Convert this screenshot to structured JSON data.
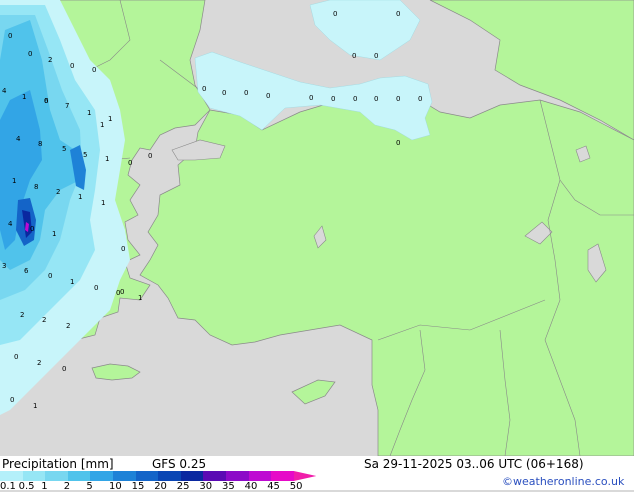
{
  "title": "Precipitation [mm]",
  "model": "GFS 0.25",
  "datetime": "Sa 29-11-2025 03..06 UTC (06+168)",
  "credit": "©weatheronline.co.uk",
  "legend": {
    "ticks": [
      "0.1",
      "0.5",
      "1",
      "2",
      "5",
      "10",
      "15",
      "20",
      "25",
      "30",
      "35",
      "40",
      "45",
      "50"
    ],
    "colors": [
      "#b4f0fa",
      "#96e6f5",
      "#78d7f0",
      "#50c3eb",
      "#32a5e6",
      "#1e82d7",
      "#1464c8",
      "#0a46b4",
      "#0a28a0",
      "#5a0ab4",
      "#8c0ac8",
      "#be0ad2",
      "#e60ac8",
      "#f01eaa"
    ]
  },
  "colors": {
    "sea": "#d9d9d9",
    "land": "#b4f59a",
    "border": "#888888",
    "light_precip": "#c8f5fa"
  },
  "point_labels": [
    "0",
    "0",
    "0",
    "0",
    "0",
    "0",
    "0",
    "0",
    "0",
    "0",
    "0",
    "0",
    "0",
    "0",
    "0",
    "0",
    "0",
    "2",
    "0",
    "0",
    "4",
    "1",
    "0",
    "6",
    "7",
    "1",
    "1",
    "1",
    "0",
    "4",
    "8",
    "5",
    "5",
    "1",
    "0",
    "1",
    "8",
    "2",
    "1",
    "1",
    "4",
    "0",
    "1",
    "0",
    "3",
    "6",
    "0",
    "1",
    "0",
    "0",
    "1",
    "0",
    "2",
    "2",
    "2",
    "0",
    "2",
    "0",
    "0",
    "1"
  ]
}
